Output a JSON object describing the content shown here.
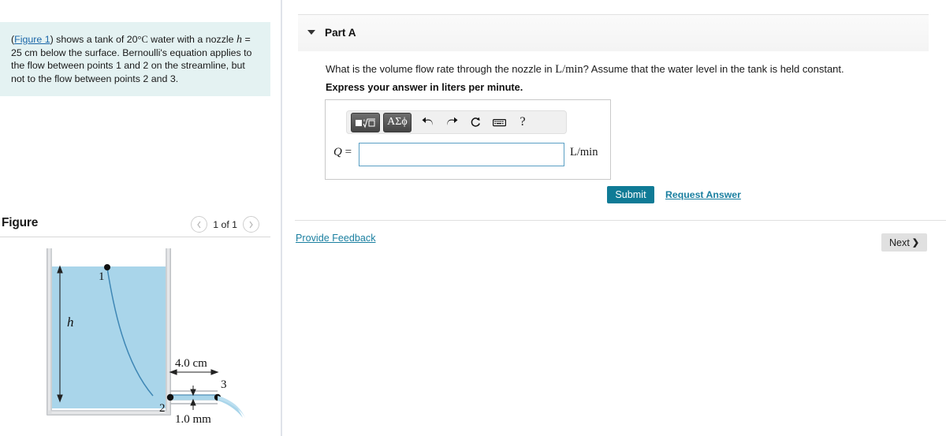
{
  "problem": {
    "figure_link": "Figure 1",
    "text_before": "(",
    "text_after": ") shows a tank of 20",
    "degree": "°",
    "temp_unit": "C",
    "text_mid": " water with a nozzle ",
    "h_symbol": "h",
    "h_value": " = 25 cm",
    "body": "below the surface. Bernoulli's equation applies to the flow between points 1 and 2 on the streamline, but not to the flow between points 2 and 3."
  },
  "figure": {
    "title": "Figure",
    "counter": "1 of 1",
    "prev_icon": "chevron-left-icon",
    "next_icon": "chevron-right-icon",
    "labels": {
      "point1": "1",
      "point2": "2",
      "point3": "3",
      "height": "h",
      "nozzle_length": "4.0 cm",
      "nozzle_diameter": "1.0 mm"
    },
    "colors": {
      "water": "#a9d5ea",
      "water_edge": "#3f87b5",
      "tank_wall": "#b8bcc0",
      "jet": "#a9d5ea"
    }
  },
  "part": {
    "caret_icon": "caret-down-icon",
    "title": "Part A",
    "question_pre": "What is the volume flow rate through the nozzle in ",
    "question_unit": "L/min",
    "question_post": "? Assume that the water level in the tank is held constant.",
    "instruction": "Express your answer in liters per minute."
  },
  "answer": {
    "toolbar": {
      "template_label": "■√□",
      "greek_label": "ΑΣϕ",
      "undo_icon": "undo-arrow-icon",
      "redo_icon": "redo-arrow-icon",
      "reset_icon": "reset-circular-arrow-icon",
      "keyboard_icon": "keyboard-icon",
      "help_label": "?"
    },
    "variable": "Q",
    "equals": "=",
    "value": "",
    "placeholder": "",
    "unit": "L/min"
  },
  "actions": {
    "submit_label": "Submit",
    "request_answer_label": "Request Answer",
    "provide_feedback_label": "Provide Feedback",
    "next_label": "Next",
    "next_chevron": "❯",
    "help_fab_icon": "help-chat-bubble-icon"
  },
  "colors": {
    "accent_teal": "#0f7b96",
    "link_blue": "#1a7fa0",
    "info_bg": "#e4f2f2",
    "panel_gray": "#f4f4f4",
    "next_gray": "#e0e0e0"
  }
}
